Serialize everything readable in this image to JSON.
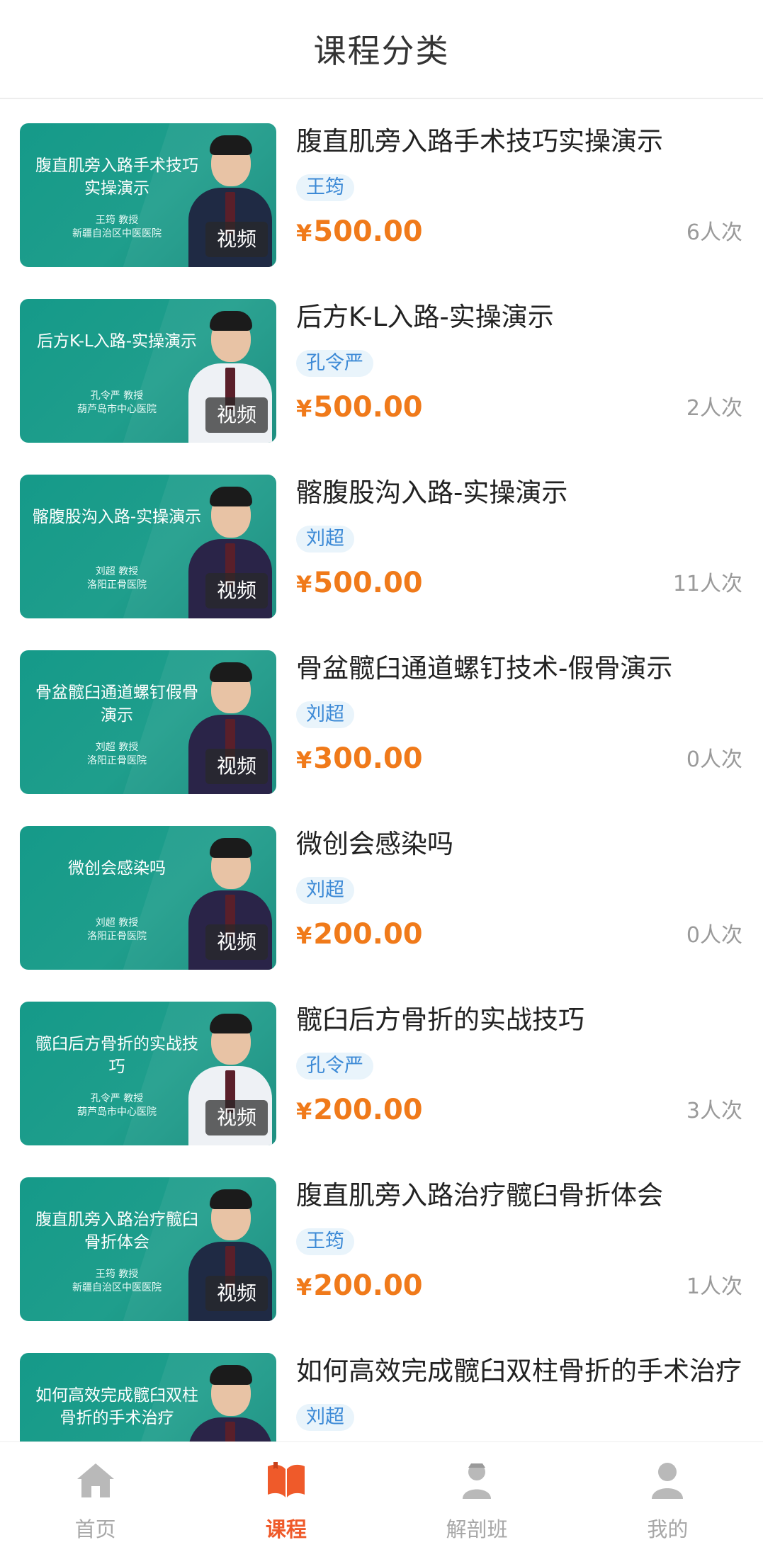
{
  "header": {
    "title": "课程分类"
  },
  "courses": [
    {
      "thumb_title": "腹直肌旁入路手术技巧实操演示",
      "thumb_doctor": "王筠 教授",
      "thumb_hospital": "新疆自治区中医医院",
      "video_label": "视频",
      "title": "腹直肌旁入路手术技巧实操演示",
      "teacher": "王筠",
      "price": "500.00",
      "currency": "¥",
      "count": "6人次",
      "portrait": "dark"
    },
    {
      "thumb_title": "后方K-L入路-实操演示",
      "thumb_doctor": "孔令严 教授",
      "thumb_hospital": "葫芦岛市中心医院",
      "video_label": "视频",
      "title": "后方K-L入路-实操演示",
      "teacher": "孔令严",
      "price": "500.00",
      "currency": "¥",
      "count": "2人次",
      "portrait": "white"
    },
    {
      "thumb_title": "髂腹股沟入路-实操演示",
      "thumb_doctor": "刘超 教授",
      "thumb_hospital": "洛阳正骨医院",
      "video_label": "视频",
      "title": "髂腹股沟入路-实操演示",
      "teacher": "刘超",
      "price": "500.00",
      "currency": "¥",
      "count": "11人次",
      "portrait": "purple"
    },
    {
      "thumb_title": "骨盆髋臼通道螺钉假骨演示",
      "thumb_doctor": "刘超 教授",
      "thumb_hospital": "洛阳正骨医院",
      "video_label": "视频",
      "title": "骨盆髋臼通道螺钉技术-假骨演示",
      "teacher": "刘超",
      "price": "300.00",
      "currency": "¥",
      "count": "0人次",
      "portrait": "purple"
    },
    {
      "thumb_title": "微创会感染吗",
      "thumb_doctor": "刘超 教授",
      "thumb_hospital": "洛阳正骨医院",
      "video_label": "视频",
      "title": "微创会感染吗",
      "teacher": "刘超",
      "price": "200.00",
      "currency": "¥",
      "count": "0人次",
      "portrait": "purple"
    },
    {
      "thumb_title": "髋臼后方骨折的实战技巧",
      "thumb_doctor": "孔令严 教授",
      "thumb_hospital": "葫芦岛市中心医院",
      "video_label": "视频",
      "title": "髋臼后方骨折的实战技巧",
      "teacher": "孔令严",
      "price": "200.00",
      "currency": "¥",
      "count": "3人次",
      "portrait": "white"
    },
    {
      "thumb_title": "腹直肌旁入路治疗髋臼骨折体会",
      "thumb_doctor": "王筠 教授",
      "thumb_hospital": "新疆自治区中医医院",
      "video_label": "视频",
      "title": "腹直肌旁入路治疗髋臼骨折体会",
      "teacher": "王筠",
      "price": "200.00",
      "currency": "¥",
      "count": "1人次",
      "portrait": "dark"
    },
    {
      "thumb_title": "如何高效完成髋臼双柱骨折的手术治疗",
      "thumb_doctor": "",
      "thumb_hospital": "",
      "video_label": "",
      "title": "如何高效完成髋臼双柱骨折的手术治疗",
      "teacher": "刘超",
      "price": "",
      "currency": "",
      "count": "",
      "portrait": "purple"
    }
  ],
  "tabbar": [
    {
      "label": "首页",
      "icon": "home-icon",
      "active": false
    },
    {
      "label": "课程",
      "icon": "book-icon",
      "active": true
    },
    {
      "label": "解剖班",
      "icon": "person-class-icon",
      "active": false
    },
    {
      "label": "我的",
      "icon": "user-icon",
      "active": false
    }
  ],
  "colors": {
    "accent": "#ef5a2a",
    "price": "#f07a1a",
    "tag_bg": "#e9f4fb",
    "tag_text": "#3d8ad6",
    "thumb_bg": "#159a89",
    "inactive": "#a8a8a8"
  }
}
